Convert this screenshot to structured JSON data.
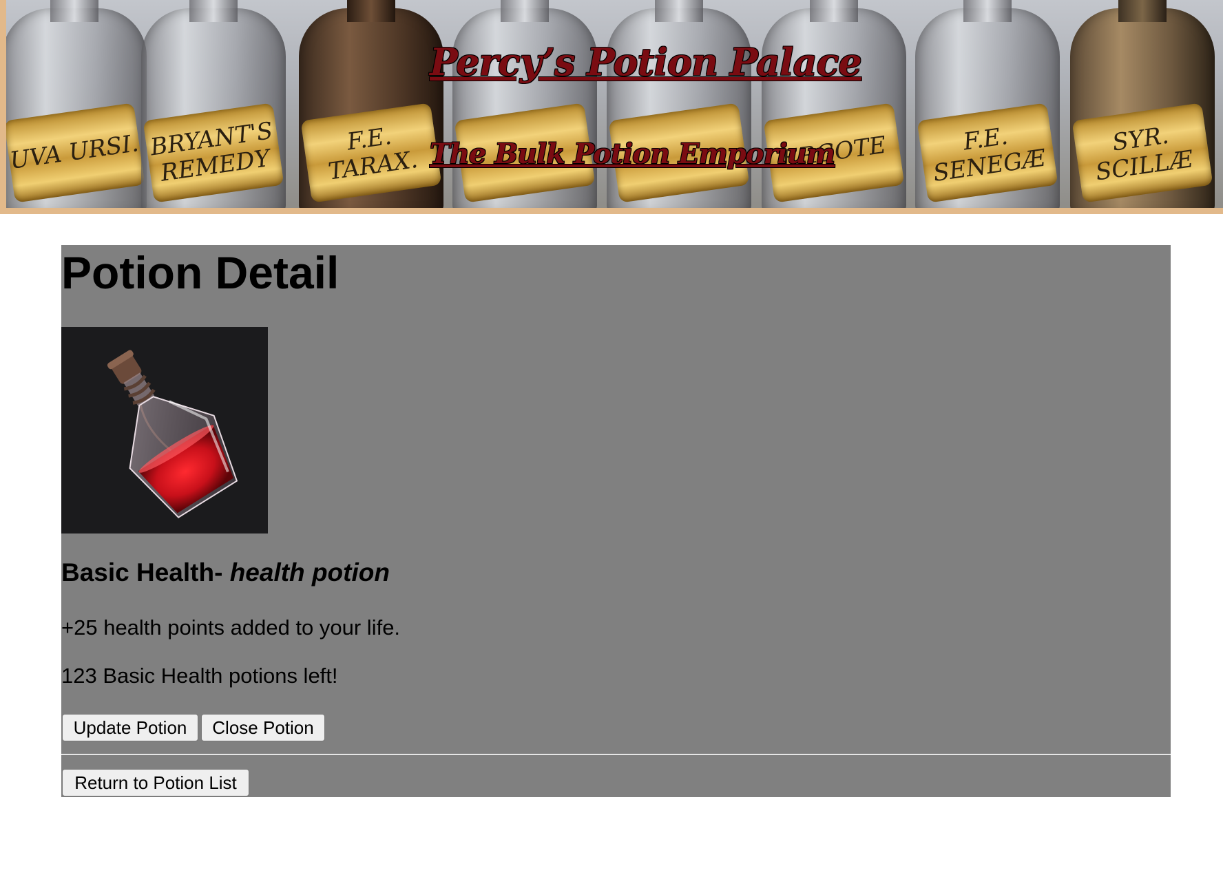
{
  "banner": {
    "title": "Percy’s Potion Palace",
    "subtitle": "The Bulk Potion Emporium",
    "bottle_labels": [
      "UVA URSI.",
      "BRYANT'S REMEDY",
      "F.E. TARAX.",
      "",
      "",
      "ERGOTE",
      "F.E. SENEGÆ",
      "SYR. SCILLÆ"
    ]
  },
  "main": {
    "heading": "Potion Detail",
    "potion": {
      "image_icon": "red-potion-bottle",
      "name": "Basic Health-",
      "type": "health potion",
      "description": "+25 health points added to your life.",
      "stock_text": "123 Basic Health potions left!"
    },
    "buttons": {
      "update": "Update Potion",
      "close": "Close Potion",
      "return": "Return to Potion List"
    }
  },
  "colors": {
    "panel_bg": "#808080",
    "banner_border": "#e2b98a",
    "title_red": "#7a0c12",
    "potion_red": "#c8101a"
  }
}
